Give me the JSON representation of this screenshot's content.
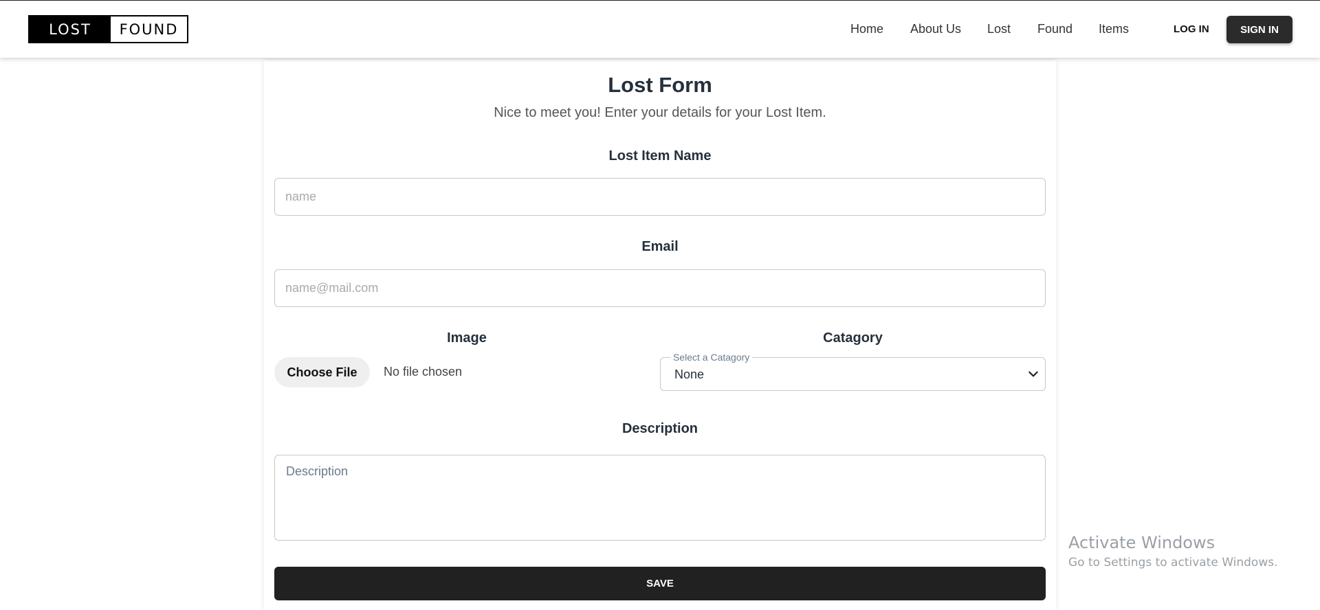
{
  "header": {
    "logo_left": "LOST",
    "logo_right": "FOUND",
    "nav": [
      "Home",
      "About Us",
      "Lost",
      "Found",
      "Items"
    ],
    "login_label": "LOG IN",
    "signin_label": "SIGN IN"
  },
  "form": {
    "title": "Lost Form",
    "subtitle": "Nice to meet you! Enter your details for your Lost Item.",
    "item_name_label": "Lost Item Name",
    "item_name_placeholder": "name",
    "email_label": "Email",
    "email_placeholder": "name@mail.com",
    "image_label": "Image",
    "choose_file_label": "Choose File",
    "file_status": "No file chosen",
    "category_label": "Catagory",
    "category_legend": "Select a Catagory",
    "category_value": "None",
    "description_label": "Description",
    "description_placeholder": "Description",
    "save_label": "SAVE"
  },
  "watermark": {
    "title": "Activate Windows",
    "subtitle": "Go to Settings to activate Windows."
  },
  "colors": {
    "accent_dark": "#212121",
    "signin_bg": "#2b2b2b"
  }
}
